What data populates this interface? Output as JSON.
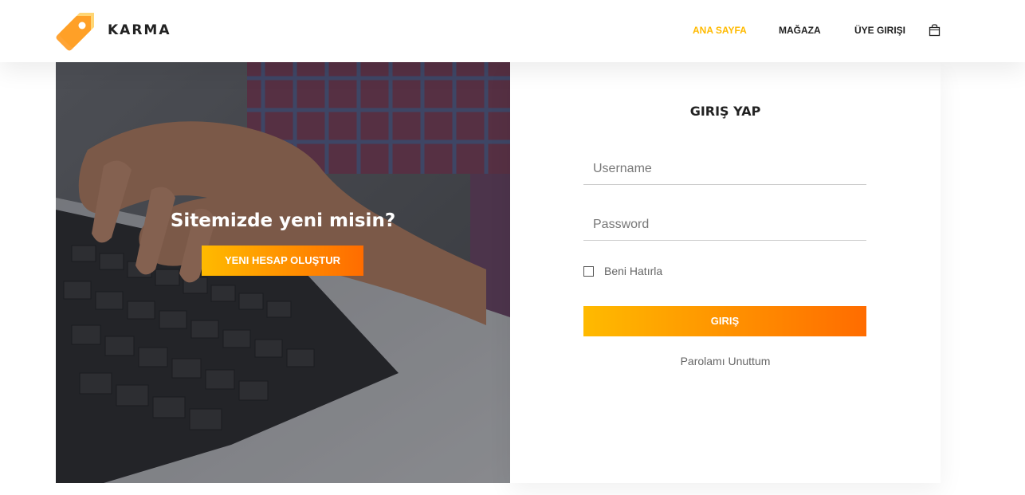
{
  "brand": {
    "name": "KARMA",
    "icon": "price-tag-logo"
  },
  "nav": {
    "items": [
      {
        "label": "ANA SAYFA",
        "active": true
      },
      {
        "label": "MAĞAZA",
        "active": false
      },
      {
        "label": "ÜYE GIRIŞI",
        "active": false
      }
    ],
    "cart_icon": "shopping-bag-icon"
  },
  "register_panel": {
    "title": "Sitemizde yeni misin?",
    "button_label": "YENI HESAP OLUŞTUR"
  },
  "login_panel": {
    "title": "GIRIŞ YAP",
    "username_placeholder": "Username",
    "username_value": "",
    "password_placeholder": "Password",
    "password_value": "",
    "remember_label": "Beni Hatırla",
    "remember_checked": false,
    "submit_label": "GIRIŞ",
    "forgot_label": "Parolamı Unuttum"
  },
  "colors": {
    "accent": "#ffba00",
    "gradient_end": "#ff6c00",
    "text_dark": "#222222",
    "text_muted": "#777777"
  }
}
